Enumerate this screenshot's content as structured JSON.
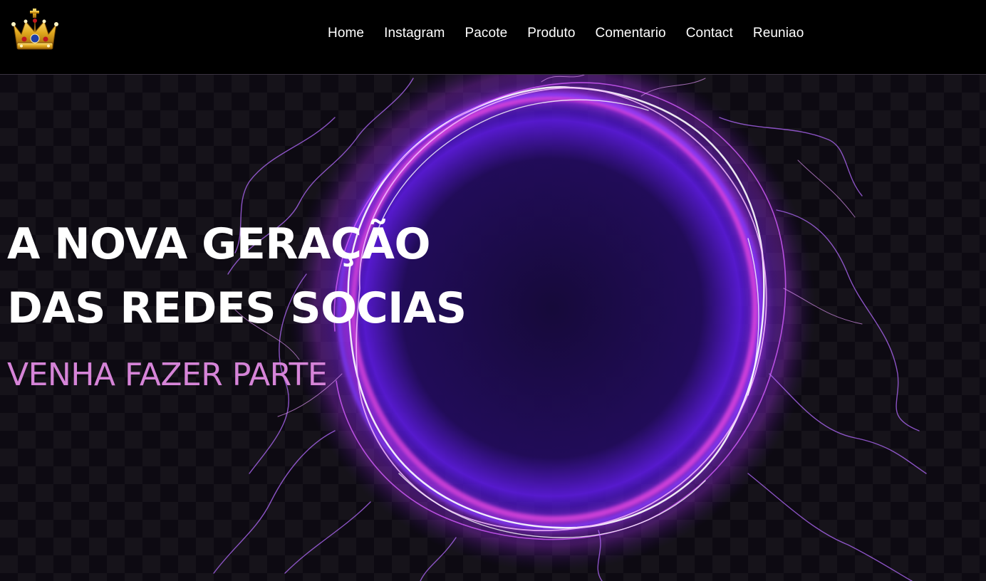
{
  "brand": {
    "logo_icon": "crown-icon"
  },
  "nav": {
    "items": [
      {
        "label": "Home"
      },
      {
        "label": "Instagram"
      },
      {
        "label": "Pacote"
      },
      {
        "label": "Produto"
      },
      {
        "label": "Comentario"
      },
      {
        "label": "Contact"
      },
      {
        "label": "Reuniao"
      }
    ]
  },
  "hero": {
    "headline_line1": "A NOVA GERAÇÃO",
    "headline_line2": "DAS REDES SOCIAS",
    "subheadline": "VENHA FAZER PARTE",
    "art_icon": "electric-ring-icon"
  },
  "colors": {
    "background": "#000000",
    "text": "#ffffff",
    "subheadline": "#d684d8",
    "ring_glow": "#c53bff",
    "ring_core": "#ffffff"
  }
}
